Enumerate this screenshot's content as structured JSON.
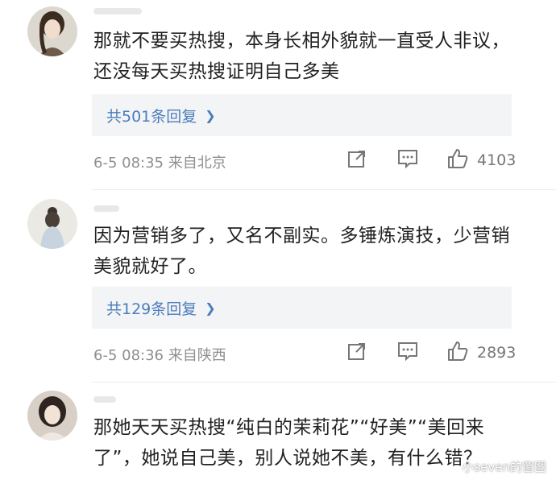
{
  "comments": [
    {
      "text": "那就不要买热搜，本身长相外貌就一直受人非议，还没每天买热搜证明自己多美",
      "reply_label": "共501条回复",
      "meta": "6-5 08:35  来自北京",
      "likes": "4103"
    },
    {
      "text": "因为营销多了，又名不副实。多锤炼演技，少营销美貌就好了。",
      "reply_label": "共129条回复",
      "meta": "6-5 08:36  来自陕西",
      "likes": "2893"
    },
    {
      "text": "那她天天买热搜“纯白的茉莉花”“好美”“美回来了”，她说自己美，别人说她不美，有什么错？"
    }
  ],
  "watermark": "小seven的窗图",
  "icons": {
    "share": "share-icon",
    "comment": "comment-icon",
    "like": "thumbs-up-icon",
    "chevron": "chevron-right-icon"
  },
  "colors": {
    "link": "#4a7dbb",
    "reply_bg": "#f3f4f6",
    "meta": "#8f8f8f"
  }
}
